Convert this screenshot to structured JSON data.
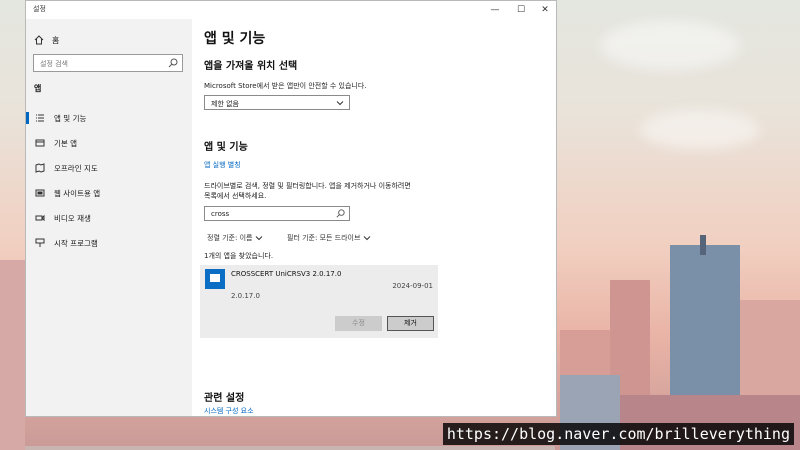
{
  "window": {
    "title": "설정",
    "controls": {
      "minimize": "—",
      "maximize": "☐",
      "close": "✕"
    }
  },
  "sidebar": {
    "home_label": "홈",
    "search_placeholder": "설정 검색",
    "section": "앱",
    "items": [
      {
        "label": "앱 및 기능",
        "icon": "apps-features-icon",
        "active": true
      },
      {
        "label": "기본 앱",
        "icon": "default-apps-icon",
        "active": false
      },
      {
        "label": "오프라인 지도",
        "icon": "offline-maps-icon",
        "active": false
      },
      {
        "label": "웹 사이트용 앱",
        "icon": "apps-for-websites-icon",
        "active": false
      },
      {
        "label": "비디오 재생",
        "icon": "video-playback-icon",
        "active": false
      },
      {
        "label": "시작 프로그램",
        "icon": "startup-icon",
        "active": false
      }
    ]
  },
  "main": {
    "title": "앱 및 기능",
    "install_section": {
      "heading": "앱을 가져올 위치 선택",
      "description": "Microsoft Store에서 받은 앱만이 안전할 수 있습니다.",
      "dropdown_value": "제한 없음"
    },
    "apps_section": {
      "heading": "앱 및 기능",
      "alias_link": "앱 실행 별칭",
      "description_line1": "드라이브별로 검색, 정렬 및 필터링합니다. 앱을 제거하거나 이동하려면",
      "description_line2": "목록에서 선택하세요.",
      "search_value": "cross",
      "sort_label": "정렬 기준: 이름",
      "filter_label": "필터 기준: 모든 드라이브",
      "results_count": "1개의 앱을 찾았습니다."
    },
    "app": {
      "name": "CROSSCERT UniCRSV3 2.0.17.0",
      "date": "2024-09-01",
      "version": "2.0.17.0",
      "modify_label": "수정",
      "remove_label": "제거"
    },
    "related": {
      "heading": "관련 설정",
      "link": "시스템 구성 요소"
    }
  },
  "watermark": "https://blog.naver.com/brilleverything",
  "colors": {
    "accent": "#0067c0",
    "sidebar_bg": "#f2f2f2",
    "card_bg": "#ececec"
  }
}
